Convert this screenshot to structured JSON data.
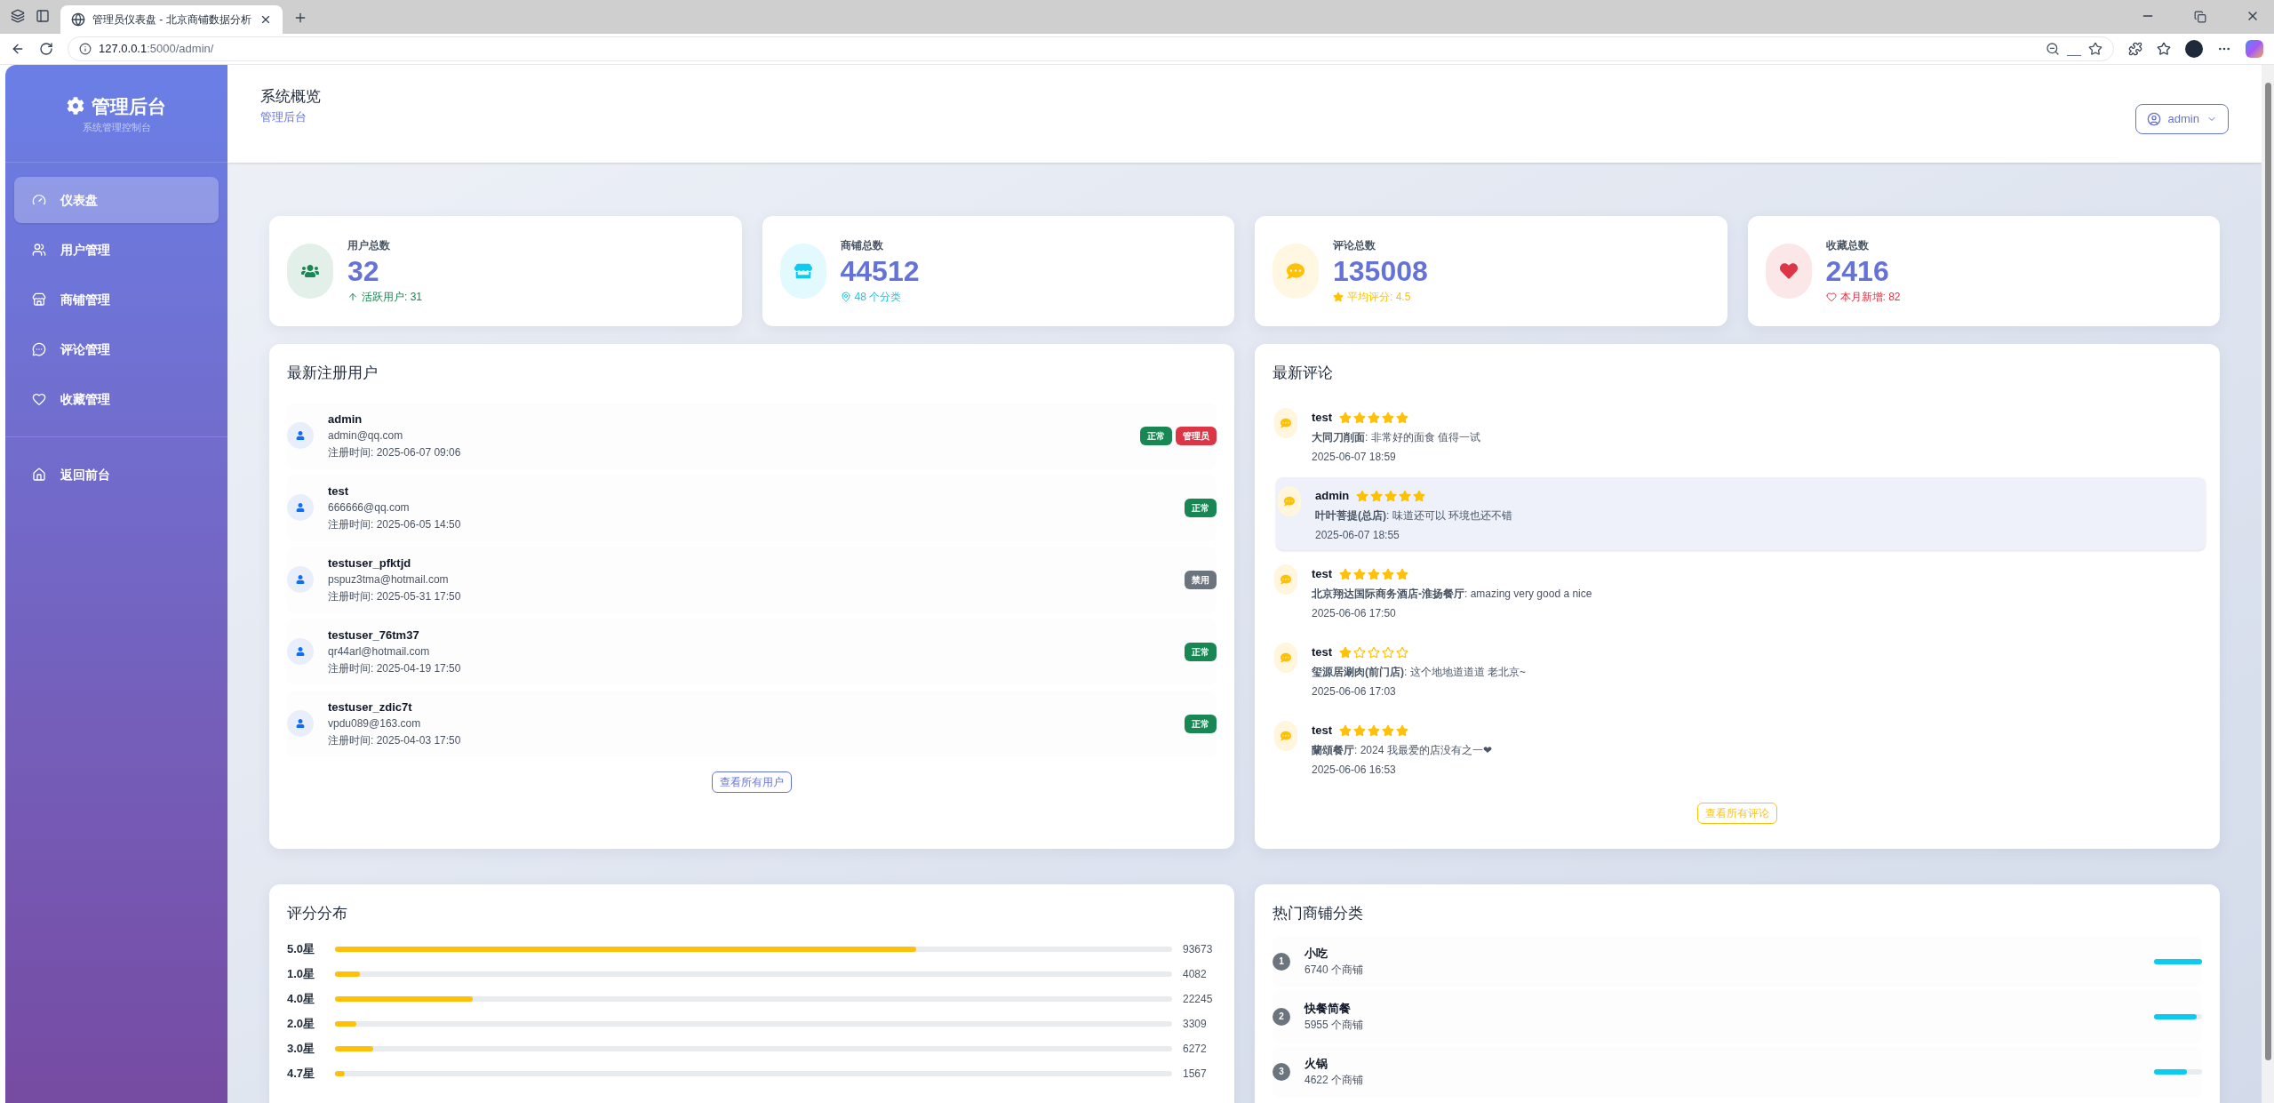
{
  "browser": {
    "tab_title": "管理员仪表盘 - 北京商铺数据分析",
    "url_host": "127.0.0.1",
    "url_path": ":5000/admin/"
  },
  "sidebar": {
    "title": "管理后台",
    "subtitle": "系统管理控制台",
    "items": [
      {
        "label": "仪表盘",
        "selected": true
      },
      {
        "label": "用户管理",
        "selected": false
      },
      {
        "label": "商铺管理",
        "selected": false
      },
      {
        "label": "评论管理",
        "selected": false
      },
      {
        "label": "收藏管理",
        "selected": false
      }
    ],
    "footer_items": [
      {
        "label": "返回前台",
        "selected": false
      }
    ]
  },
  "header": {
    "title": "系统概览",
    "breadcrumb": "管理后台",
    "user_menu": "admin"
  },
  "stats": [
    {
      "label": "用户总数",
      "value": "32",
      "note": "活跃用户: 31",
      "color": "#198754"
    },
    {
      "label": "商铺总数",
      "value": "44512",
      "note": "48 个分类",
      "color": "#0dcaf0"
    },
    {
      "label": "评论总数",
      "value": "135008",
      "note": "平均评分: 4.5",
      "color": "#ffc107"
    },
    {
      "label": "收藏总数",
      "value": "2416",
      "note": "本月新增: 82",
      "color": "#dc3545"
    }
  ],
  "new_users": {
    "title": "最新注册用户",
    "button": "查看所有用户",
    "users": [
      {
        "name": "admin",
        "email": "admin@qq.com",
        "registered": "注册时间: 2025-06-07 09:06",
        "badges": [
          {
            "text": "正常",
            "color": "#198754"
          },
          {
            "text": "管理员",
            "color": "#dc3545"
          }
        ]
      },
      {
        "name": "test",
        "email": "666666@qq.com",
        "registered": "注册时间: 2025-06-05 14:50",
        "badges": [
          {
            "text": "正常",
            "color": "#198754"
          }
        ]
      },
      {
        "name": "testuser_pfktjd",
        "email": "pspuz3tma@hotmail.com",
        "registered": "注册时间: 2025-05-31 17:50",
        "badges": [
          {
            "text": "禁用",
            "color": "#6c757d"
          }
        ]
      },
      {
        "name": "testuser_76tm37",
        "email": "qr44arl@hotmail.com",
        "registered": "注册时间: 2025-04-19 17:50",
        "badges": [
          {
            "text": "正常",
            "color": "#198754"
          }
        ]
      },
      {
        "name": "testuser_zdic7t",
        "email": "vpdu089@163.com",
        "registered": "注册时间: 2025-04-03 17:50",
        "badges": [
          {
            "text": "正常",
            "color": "#198754"
          }
        ]
      }
    ]
  },
  "latest_reviews": {
    "title": "最新评论",
    "button": "查看所有评论",
    "reviews": [
      {
        "user": "test",
        "stars": 5,
        "text": "**大同刀削面**: 非常好的面食 值得一试",
        "time": "2025-06-07 18:59",
        "highlighted": false
      },
      {
        "user": "admin",
        "stars": 5,
        "text": "**叶叶菩提(总店)**: 味道还可以 环境也还不错",
        "time": "2025-06-07 18:55",
        "highlighted": true
      },
      {
        "user": "test",
        "stars": 5,
        "text": "**北京翔达国际商务酒店-淮扬餐厅**: amazing very good a nice",
        "time": "2025-06-06 17:50",
        "highlighted": false
      },
      {
        "user": "test",
        "stars": 1,
        "text": "**玺源居涮肉(前门店)**: 这个地地道道道 老北京~",
        "time": "2025-06-06 17:03",
        "highlighted": false
      },
      {
        "user": "test",
        "stars": 5,
        "text": "**蘭頌餐厅**: 2024 我最爱的店没有之一❤",
        "time": "2025-06-06 16:53",
        "highlighted": false
      }
    ]
  },
  "rating_distribution": {
    "title": "评分分布",
    "rows": [
      {
        "label": "5.0星",
        "level": 0.694,
        "count": "93673"
      },
      {
        "label": "1.0星",
        "level": 0.03,
        "count": "4082"
      },
      {
        "label": "4.0星",
        "level": 0.165,
        "count": "22245"
      },
      {
        "label": "2.0星",
        "level": 0.025,
        "count": "3309"
      },
      {
        "label": "3.0星",
        "level": 0.046,
        "count": "6272"
      },
      {
        "label": "4.7星",
        "level": 0.012,
        "count": "1567"
      }
    ]
  },
  "hot_categories": {
    "title": "热门商铺分类",
    "items": [
      {
        "rank": "1",
        "name": "小吃",
        "count": "6740 个商铺",
        "level": 1
      },
      {
        "rank": "2",
        "name": "快餐简餐",
        "count": "5955 个商铺",
        "level": 0.88
      },
      {
        "rank": "3",
        "name": "火锅",
        "count": "4622 个商铺",
        "level": 0.69
      }
    ]
  }
}
